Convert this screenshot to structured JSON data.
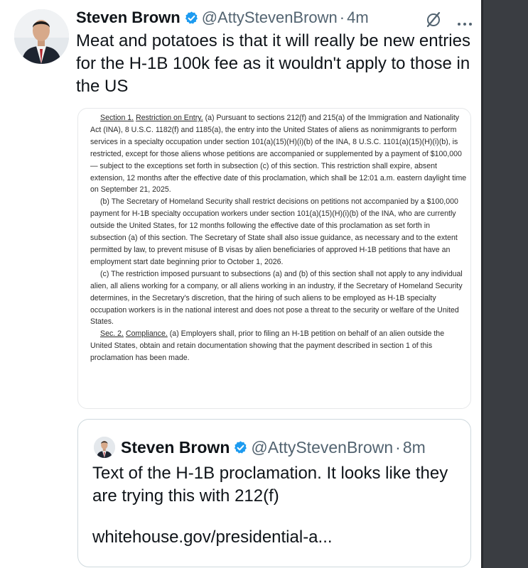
{
  "tweet": {
    "author_name": "Steven Brown",
    "handle": "@AttyStevenBrown",
    "separator": "·",
    "time": "4m",
    "text": "Meat and potatoes is that it will really be new entries for the H-1B 100k fee as it wouldn't apply to those in the US"
  },
  "document": {
    "p1_section": "Section 1.",
    "p1_heading": "Restriction on Entry.",
    "p1_body": "(a) Pursuant to sections 212(f) and 215(a) of the Immigration and Nationality Act (INA), 8 U.S.C. 1182(f) and 1185(a), the entry into the United States of aliens as nonimmigrants to perform services in a specialty occupation under section 101(a)(15)(H)(i)(b) of the INA, 8 U.S.C. 1101(a)(15)(H)(i)(b), is restricted, except for those aliens whose petitions are accompanied or supplemented by a payment of $100,000 — subject to the exceptions set forth in subsection (c) of this section. This restriction shall expire, absent extension, 12 months after the effective date of this proclamation, which shall be 12:01 a.m. eastern daylight time on September 21, 2025.",
    "p2": "(b) The Secretary of Homeland Security shall restrict decisions on petitions not accompanied by a $100,000 payment for H-1B specialty occupation workers under section 101(a)(15)(H)(i)(b) of the INA, who are currently outside the United States, for 12 months following the effective date of this proclamation as set forth in subsection (a) of this section. The Secretary of State shall also issue guidance, as necessary and to the extent permitted by law, to prevent misuse of B visas by alien beneficiaries of approved H-1B petitions that have an employment start date beginning prior to October 1, 2026.",
    "p3": "(c) The restriction imposed pursuant to subsections (a) and (b) of this section shall not apply to any individual alien, all aliens working for a company, or all aliens working in an industry, if the Secretary of Homeland Security determines, in the Secretary's discretion, that the hiring of such aliens to be employed as H-1B specialty occupation workers is in the national interest and does not pose a threat to the security or welfare of the United States.",
    "p4_section": "Sec. 2.",
    "p4_heading": "Compliance.",
    "p4_body": "(a) Employers shall, prior to filing an H-1B petition on behalf of an alien outside the United States, obtain and retain documentation showing that the payment described in section 1 of this proclamation has been made."
  },
  "quote": {
    "author_name": "Steven Brown",
    "handle": "@AttyStevenBrown",
    "separator": "·",
    "time": "8m",
    "text": "Text of the H-1B proclamation. It looks like they are trying this with 212(f)",
    "link": "whitehouse.gov/presidential-a..."
  },
  "icons": {
    "verified": "verified-badge-icon",
    "grok": "grok-icon",
    "more": "more-icon"
  },
  "colors": {
    "verified_blue": "#1d9bf0",
    "secondary_text": "#536471",
    "primary_text": "#0f1419",
    "border": "#cfd9de"
  }
}
